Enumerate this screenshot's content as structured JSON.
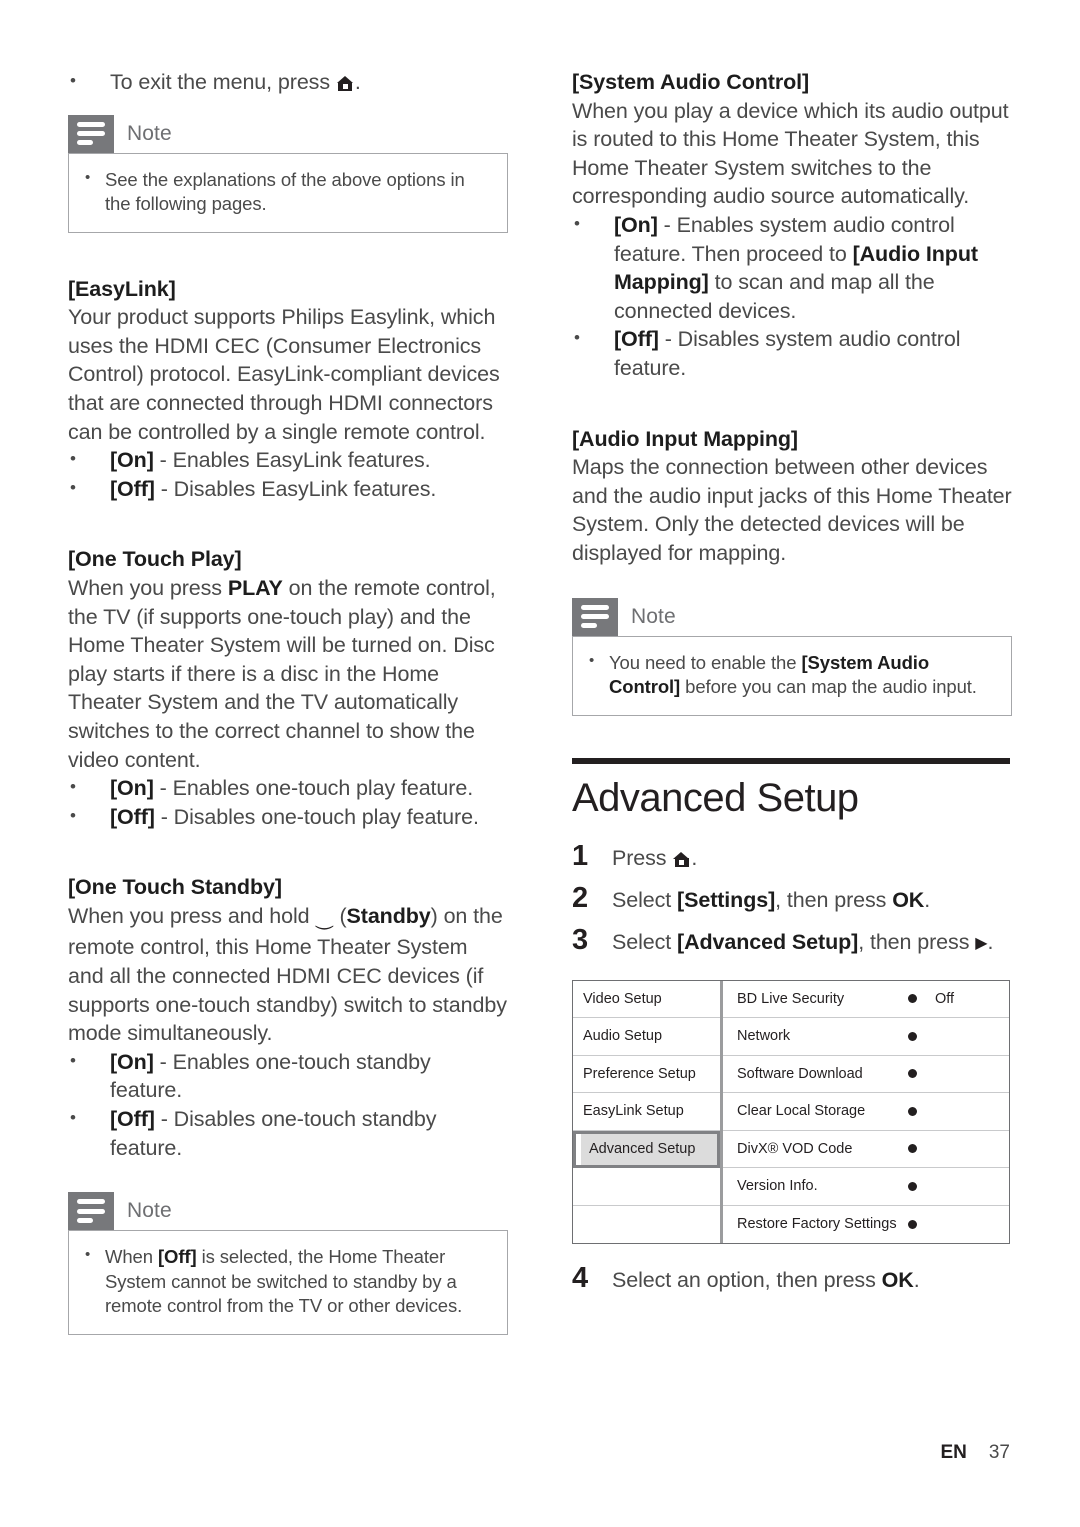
{
  "footer": {
    "language": "EN",
    "page_number": "37"
  },
  "left_column": {
    "intro_bullet": "To exit the menu, press",
    "note1": {
      "title": "Note",
      "bullets": [
        "See the explanations of the above options in the following pages."
      ]
    },
    "easylink": {
      "heading": "[EasyLink]",
      "paragraph": "Your product supports Philips Easylink, which uses the HDMI CEC (Consumer Electronics Control) protocol. EasyLink-compliant devices that are connected through HDMI connectors can be controlled by a single remote control.",
      "options": [
        {
          "key": "[On]",
          "desc": "- Enables EasyLink features."
        },
        {
          "key": "[Off]",
          "desc": "- Disables EasyLink features."
        }
      ]
    },
    "one_touch_play": {
      "heading": "[One Touch Play]",
      "para_part1": "When you press",
      "para_bold": "PLAY",
      "para_part2": "on the remote control, the TV (if supports one-touch play) and the Home Theater System will be turned on. Disc play starts if there is a disc in the Home Theater System and the TV automatically switches to the correct channel to show the video content.",
      "options": [
        {
          "key": "[On]",
          "desc": "- Enables one-touch play feature."
        },
        {
          "key": "[Off]",
          "desc": "- Disables one-touch play feature."
        }
      ]
    },
    "one_touch_standby": {
      "heading": "[One Touch Standby]",
      "para_part1": "When you press and hold",
      "para_bold": "Standby",
      "para_part2": "on the remote control, this Home Theater System and all the connected HDMI CEC devices (if supports one-touch standby) switch to standby mode simultaneously.",
      "options": [
        {
          "key": "[On]",
          "desc": "- Enables one-touch standby feature."
        },
        {
          "key": "[Off]",
          "desc": "- Disables one-touch standby feature."
        }
      ]
    },
    "note2": {
      "title": "Note",
      "bullet_part1": "When",
      "bullet_bold": "[Off]",
      "bullet_part2": "is selected, the Home Theater System cannot be switched to standby by a remote control from the TV or other devices."
    }
  },
  "right_column": {
    "system_audio_control": {
      "heading": "[System Audio Control]",
      "paragraph": "When you play a device which its audio output is routed to this Home Theater System, this Home Theater System switches to the corresponding audio source automatically.",
      "option_on_key": "[On]",
      "option_on_part1": "- Enables system audio control feature. Then proceed to",
      "option_on_bold": "[Audio Input Mapping]",
      "option_on_part2": "to scan and map all the connected devices.",
      "option_off_key": "[Off]",
      "option_off_desc": "- Disables system audio control feature."
    },
    "audio_input_mapping": {
      "heading": "[Audio Input Mapping]",
      "paragraph": "Maps the connection between other devices and the audio input jacks of this Home Theater System. Only the detected devices will be displayed for mapping."
    },
    "note3": {
      "title": "Note",
      "bullet_part1": "You need to enable the",
      "bullet_bold": "[System Audio Control]",
      "bullet_part2": "before you can map the audio input."
    },
    "advanced_setup": {
      "title": "Advanced Setup",
      "steps": [
        {
          "num": "1",
          "pre": "Press",
          "bold": "",
          "post": ""
        },
        {
          "num": "2",
          "pre": "Select",
          "bold": "[Settings]",
          "post": ", then press",
          "bold2": "OK",
          "tail": "."
        },
        {
          "num": "3",
          "pre": "Select",
          "bold": "[Advanced Setup]",
          "post": ", then press",
          "bold2": "",
          "tail": "."
        }
      ],
      "step4": {
        "num": "4",
        "pre": "Select an option, then press",
        "bold": "OK",
        "tail": "."
      }
    },
    "settings_menu": {
      "left_items": [
        "Video Setup",
        "Audio Setup",
        "Preference Setup",
        "EasyLink Setup",
        "Advanced Setup",
        "",
        ""
      ],
      "selected_left_index": 4,
      "right_items": [
        {
          "label": "BD Live Security",
          "value": "Off"
        },
        {
          "label": "Network",
          "value": ""
        },
        {
          "label": "Software Download",
          "value": ""
        },
        {
          "label": "Clear Local Storage",
          "value": ""
        },
        {
          "label": "DivX® VOD Code",
          "value": ""
        },
        {
          "label": "Version Info.",
          "value": ""
        },
        {
          "label": "Restore Factory Settings",
          "value": ""
        }
      ]
    }
  }
}
